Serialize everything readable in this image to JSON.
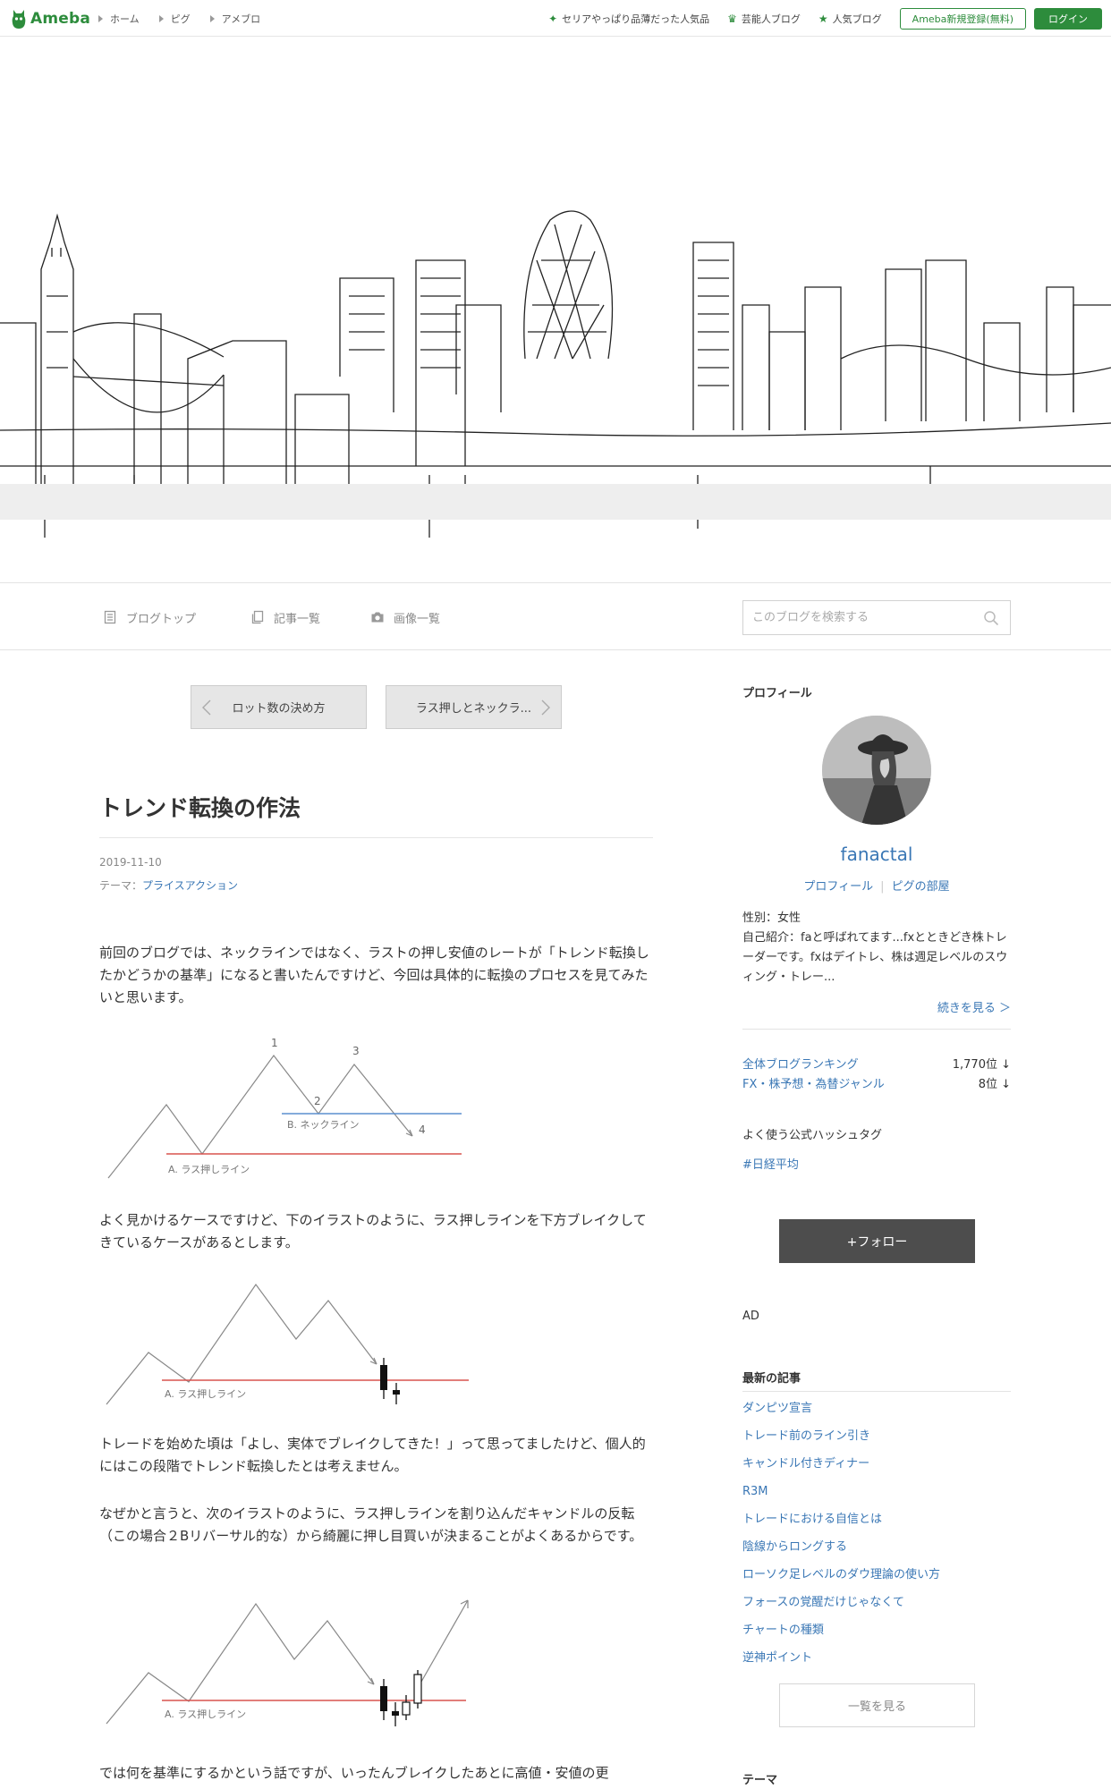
{
  "topbar": {
    "logo": "Ameba",
    "breadcrumbs": [
      "ホーム",
      "ピグ",
      "アメブロ"
    ],
    "links": [
      {
        "label": "セリアやっぱり品薄だった人気品",
        "icon": "sparkle-icon"
      },
      {
        "label": "芸能人ブログ",
        "icon": "crown-icon"
      },
      {
        "label": "人気ブログ",
        "icon": "star-icon"
      }
    ],
    "register": "Ameba新規登録(無料)",
    "login": "ログイン"
  },
  "subnav": {
    "items": [
      "ブログトップ",
      "記事一覧",
      "画像一覧"
    ],
    "search_placeholder": "このブログを検索する"
  },
  "article": {
    "prev": "ロット数の決め方",
    "next": "ラス押しとネックラ...",
    "title": "トレンド転換の作法",
    "date": "2019-11-10",
    "theme_prefix": "テーマ：",
    "theme": "プライスアクション",
    "p1": "前回のブログでは、ネックラインではなく、ラストの押し安値のレートが「トレンド転換したかどうかの基準」になると書いたんですけど、今回は具体的に転換のプロセスを見てみたいと思います。",
    "fig1": {
      "n1": "1",
      "n2": "2",
      "n3": "3",
      "n4": "4",
      "neck": "B. ネックライン",
      "last": "A. ラス押しライン"
    },
    "p2": "よく見かけるケースですけど、下のイラストのように、ラス押しラインを下方ブレイクしてきているケースがあるとします。",
    "fig2": {
      "last": "A. ラス押しライン"
    },
    "p3": "トレードを始めた頃は「よし、実体でブレイクしてきた！」って思ってましたけど、個人的にはこの段階でトレンド転換したとは考えません。",
    "p4": "なぜかと言うと、次のイラストのように、ラス押しラインを割り込んだキャンドルの反転（この場合２Bリバーサル的な）から綺麗に押し目買いが決まることがよくあるからです。",
    "fig3": {
      "last": "A. ラス押しライン"
    },
    "p5": "では何を基準にするかという話ですが、いったんブレイクしたあとに高値・安値の更"
  },
  "sidebar": {
    "profile_head": "プロフィール",
    "name": "fanactal",
    "link_profile": "プロフィール",
    "link_room": "ピグの部屋",
    "gender": "性別：女性",
    "intro": "自己紹介：faと呼ばれてます...fxとときどき株トレーダーです。fxはデイトレ、株は週足レベルのスウィング・トレー...",
    "more": "続きを見る ＞",
    "rankings": [
      {
        "name": "全体ブログランキング",
        "value": "1,770位 ↓"
      },
      {
        "name": "FX・株予想・為替ジャンル",
        "value": "8位 ↓"
      }
    ],
    "hashtag_head": "よく使う公式ハッシュタグ",
    "hashtag": "#日経平均",
    "follow": "+フォロー",
    "ad": "AD",
    "recent_head": "最新の記事",
    "recent": [
      "ダンピツ宣言",
      "トレード前のライン引き",
      "キャンドル付きディナー",
      "R3M",
      "トレードにおける自信とは",
      "陰線からロングする",
      "ローソク足レベルのダウ理論の使い方",
      "フォースの覚醒だけじゃなくて",
      "チャートの種類",
      "逆神ポイント"
    ],
    "list_all": "一覧を見る",
    "theme_head": "テーマ"
  },
  "colors": {
    "brand": "#2d8c3c",
    "link": "#3a77b5",
    "neckline": "#5b8fcf",
    "lastline": "#d9534f"
  }
}
